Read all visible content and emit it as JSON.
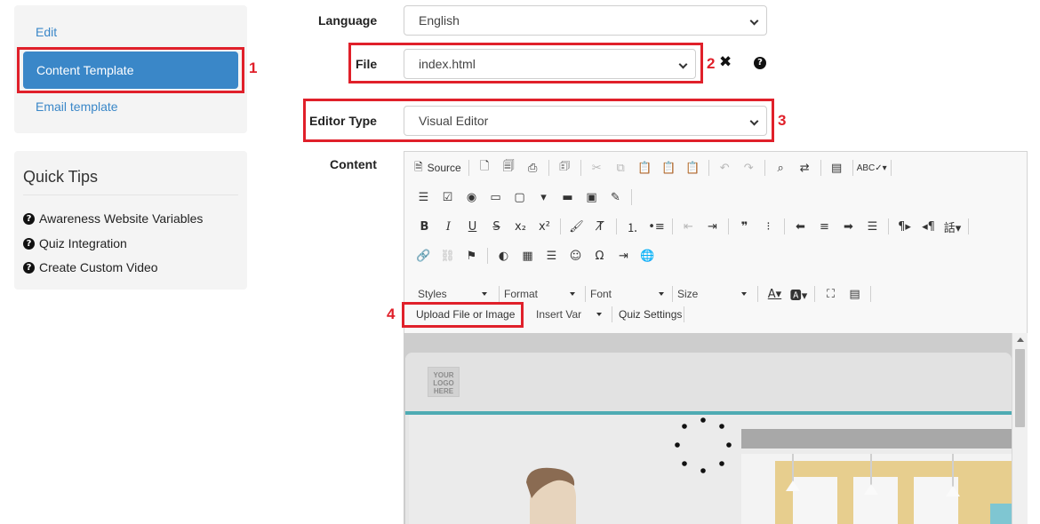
{
  "sidebar": {
    "nav": {
      "edit": "Edit",
      "content_template": "Content Template",
      "email_template": "Email template"
    },
    "quick_tips": {
      "title": "Quick Tips",
      "items": [
        "Awareness Website Variables",
        "Quiz Integration",
        "Create Custom Video"
      ]
    }
  },
  "form": {
    "language": {
      "label": "Language",
      "value": "English"
    },
    "file": {
      "label": "File",
      "value": "index.html"
    },
    "editor_type": {
      "label": "Editor Type",
      "value": "Visual Editor"
    },
    "content": {
      "label": "Content"
    }
  },
  "callouts": [
    "1",
    "2",
    "3",
    "4"
  ],
  "toolbar": {
    "source_label": "Source",
    "styles_label": "Styles",
    "format_label": "Format",
    "font_label": "Font",
    "size_label": "Size",
    "upload_label": "Upload File or Image",
    "insert_var_label": "Insert Var",
    "quiz_settings_label": "Quiz Settings",
    "spell_label": "ABC"
  },
  "preview": {
    "logo_text": "YOUR LOGO HERE"
  },
  "colors": {
    "accent": "#3a87c8",
    "callout": "#e0202a",
    "teal": "#4eabb3"
  }
}
